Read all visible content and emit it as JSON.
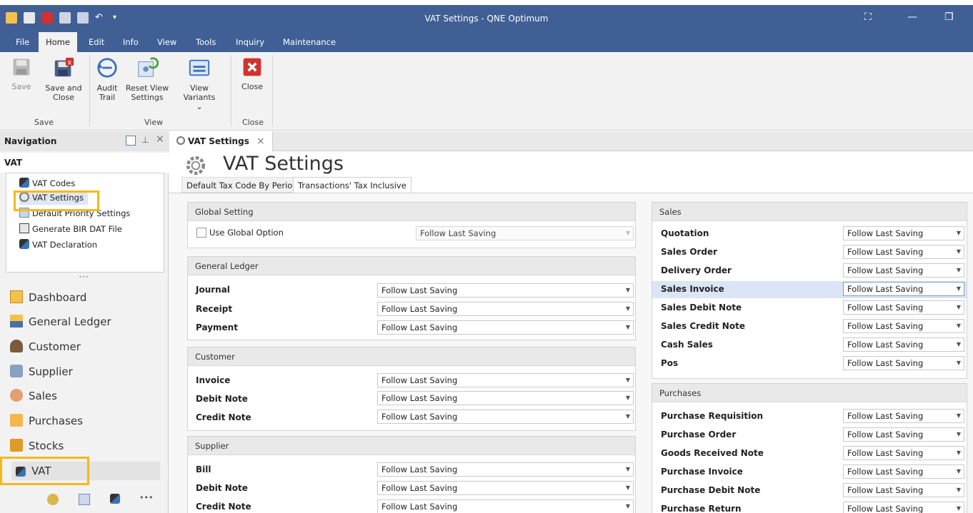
{
  "window": {
    "title": "VAT Settings - QNE Optimum"
  },
  "menu": {
    "items": [
      "File",
      "Home",
      "Edit",
      "Info",
      "View",
      "Tools",
      "Inquiry",
      "Maintenance"
    ]
  },
  "ribbon": {
    "save": "Save",
    "save_and_close_1": "Save and",
    "save_and_close_2": "Close",
    "audit_trail_1": "Audit",
    "audit_trail_2": "Trail",
    "reset_view_1": "Reset View",
    "reset_view_2": "Settings",
    "view_variants": "View Variants",
    "close": "Close",
    "group_save": "Save",
    "group_view": "View",
    "group_close": "Close"
  },
  "navigation": {
    "header": "Navigation",
    "group": "VAT",
    "items": [
      "VAT Codes",
      "VAT Settings",
      "Default Priority Settings",
      "Generate BIR DAT File",
      "VAT Declaration"
    ],
    "modules": [
      "Dashboard",
      "General Ledger",
      "Customer",
      "Supplier",
      "Sales",
      "Purchases",
      "Stocks",
      "VAT"
    ],
    "more": "•••"
  },
  "document_tab": {
    "label": "VAT Settings",
    "close": "×"
  },
  "page": {
    "title": "VAT Settings",
    "tabs": [
      "Default Tax Code By Period",
      "Transactions' Tax Inclusive"
    ]
  },
  "global_setting": {
    "title": "Global Setting",
    "checkbox_label": "Use Global Option",
    "value": "Follow Last Saving"
  },
  "general_ledger": {
    "title": "General Ledger",
    "rows": [
      {
        "label": "Journal",
        "value": "Follow Last Saving"
      },
      {
        "label": "Receipt",
        "value": "Follow Last Saving"
      },
      {
        "label": "Payment",
        "value": "Follow Last Saving"
      }
    ]
  },
  "customer": {
    "title": "Customer",
    "rows": [
      {
        "label": "Invoice",
        "value": "Follow Last Saving"
      },
      {
        "label": "Debit Note",
        "value": "Follow Last Saving"
      },
      {
        "label": "Credit Note",
        "value": "Follow Last Saving"
      }
    ]
  },
  "supplier": {
    "title": "Supplier",
    "rows": [
      {
        "label": "Bill",
        "value": "Follow Last Saving"
      },
      {
        "label": "Debit Note",
        "value": "Follow Last Saving"
      },
      {
        "label": "Credit Note",
        "value": "Follow Last Saving"
      }
    ]
  },
  "sales": {
    "title": "Sales",
    "rows": [
      {
        "label": "Quotation",
        "value": "Follow Last Saving"
      },
      {
        "label": "Sales Order",
        "value": "Follow Last Saving"
      },
      {
        "label": "Delivery Order",
        "value": "Follow Last Saving"
      },
      {
        "label": "Sales Invoice",
        "value": "Follow Last Saving"
      },
      {
        "label": "Sales Debit Note",
        "value": "Follow Last Saving"
      },
      {
        "label": "Sales Credit Note",
        "value": "Follow Last Saving"
      },
      {
        "label": "Cash Sales",
        "value": "Follow Last Saving"
      },
      {
        "label": "Pos",
        "value": "Follow Last Saving"
      }
    ]
  },
  "purchases": {
    "title": "Purchases",
    "rows": [
      {
        "label": "Purchase Requisition",
        "value": "Follow Last Saving"
      },
      {
        "label": "Purchase Order",
        "value": "Follow Last Saving"
      },
      {
        "label": "Goods Received Note",
        "value": "Follow Last Saving"
      },
      {
        "label": "Purchase Invoice",
        "value": "Follow Last Saving"
      },
      {
        "label": "Purchase Debit Note",
        "value": "Follow Last Saving"
      },
      {
        "label": "Purchase Return",
        "value": "Follow Last Saving"
      }
    ]
  },
  "colors": {
    "title_bar": "#3f5f95",
    "highlight": "#f6b81a",
    "selected_row": "#dbe5f6"
  }
}
